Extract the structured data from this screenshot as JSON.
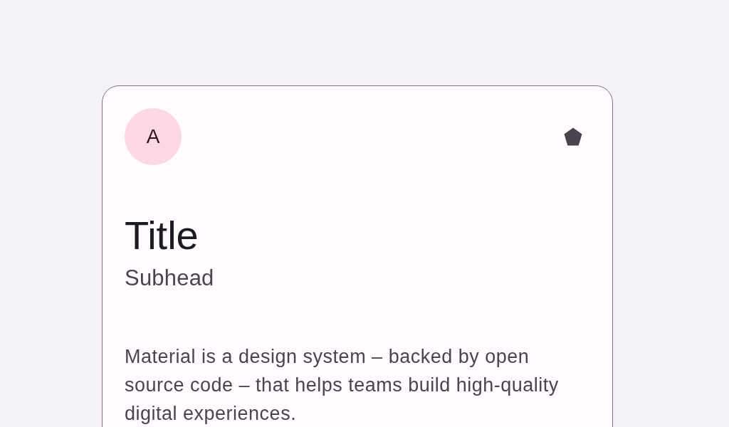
{
  "card": {
    "avatar": {
      "letter": "A"
    },
    "title": "Title",
    "subhead": "Subhead",
    "body": "Material is a design system – backed by open source code – that helps teams build high-quality digital experiences."
  }
}
